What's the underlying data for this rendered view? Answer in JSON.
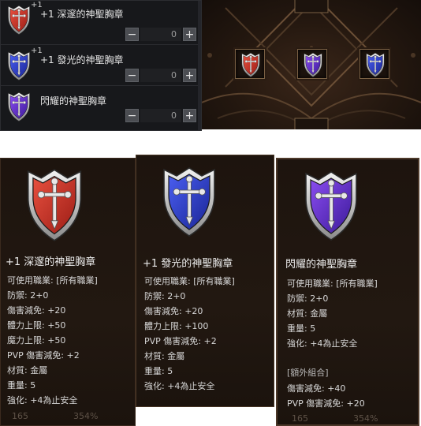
{
  "inventory": {
    "items": [
      {
        "badge": "+1",
        "name": "+1 深邃的神聖胸章",
        "value": "0",
        "minus": "−",
        "plus": "+",
        "color": "red",
        "icon": "red-shield-icon"
      },
      {
        "badge": "+1",
        "name": "+1 發光的神聖胸章",
        "value": "0",
        "minus": "−",
        "plus": "+",
        "color": "blue",
        "icon": "blue-shield-icon"
      },
      {
        "badge": "",
        "name": "閃耀的神聖胸章",
        "value": "0",
        "minus": "−",
        "plus": "+",
        "color": "purple",
        "icon": "purple-shield-icon"
      }
    ]
  },
  "slots": [
    {
      "color": "red",
      "icon": "red-shield-icon"
    },
    {
      "color": "purple",
      "icon": "purple-shield-icon"
    },
    {
      "color": "blue",
      "icon": "blue-shield-icon"
    }
  ],
  "colors": {
    "red": [
      "#e8503f",
      "#9c1d16"
    ],
    "blue": [
      "#4a5ef0",
      "#1a2596"
    ],
    "purple": [
      "#8a4df0",
      "#3c1a9a"
    ]
  },
  "tooltips": [
    {
      "title": "+1 深邃的神聖胸章",
      "lines": [
        "可使用職業: [所有職業]",
        "防禦: 2+0",
        "傷害減免: +20",
        "體力上限: +50",
        "魔力上限: +50",
        "PVP 傷害減免: +2",
        "材質: 金屬",
        "重量: 5",
        "強化: +4為止安全"
      ],
      "faint": [
        "165",
        "354%"
      ]
    },
    {
      "title": "+1 發光的神聖胸章",
      "lines": [
        "可使用職業: [所有職業]",
        "防禦: 2+0",
        "傷害減免: +20",
        "體力上限: +100",
        "PVP 傷害減免: +2",
        "材質: 金屬",
        "重量: 5",
        "強化: +4為止安全"
      ],
      "faint": []
    },
    {
      "title": "閃耀的神聖胸章",
      "lines": [
        "可使用職業: [所有職業]",
        "防禦: 2+0",
        "材質: 金屬",
        "重量: 5",
        "強化: +4為止安全"
      ],
      "extra_header": "[額外組合]",
      "extra_lines": [
        "傷害減免: +40",
        "PVP 傷害減免: +20"
      ],
      "faint": [
        "165",
        "354%"
      ]
    }
  ]
}
